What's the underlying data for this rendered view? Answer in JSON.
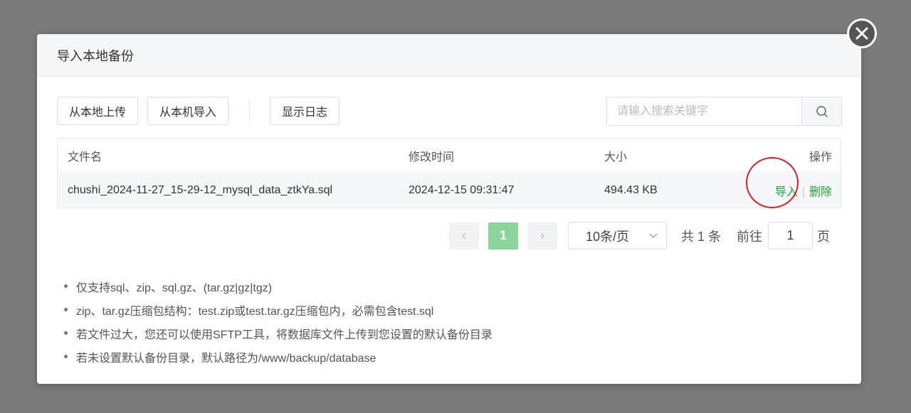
{
  "dialog": {
    "title": "导入本地备份"
  },
  "toolbar": {
    "upload_label": "从本地上传",
    "import_local_label": "从本机导入",
    "show_log_label": "显示日志"
  },
  "search": {
    "placeholder": "请输入搜索关键字"
  },
  "table": {
    "headers": {
      "name": "文件名",
      "time": "修改时间",
      "size": "大小",
      "ops": "操作"
    },
    "rows": [
      {
        "name": "chushi_2024-11-27_15-29-12_mysql_data_ztkYa.sql",
        "time": "2024-12-15 09:31:47",
        "size": "494.43 KB",
        "import_label": "导入",
        "delete_label": "删除"
      }
    ]
  },
  "pagination": {
    "prev": "‹",
    "next": "›",
    "current_page": "1",
    "page_size": "10条/页",
    "total": "共 1 条",
    "goto_label": "前往",
    "goto_value": "1",
    "goto_suffix": "页"
  },
  "notes": [
    "仅支持sql、zip、sql.gz、(tar.gz|gz|tgz)",
    "zip、tar.gz压缩包结构：test.zip或test.tar.gz压缩包内，必需包含test.sql",
    "若文件过大，您还可以使用SFTP工具，将数据库文件上传到您设置的默认备份目录",
    "若未设置默认备份目录，默认路径为/www/backup/database"
  ],
  "colors": {
    "accent": "#20a53a",
    "overlay": "#7a7a7a",
    "highlight": "#e02020"
  },
  "icons": {
    "close": "close-icon",
    "search": "search-icon",
    "dropdown": "chevron-down-icon"
  }
}
